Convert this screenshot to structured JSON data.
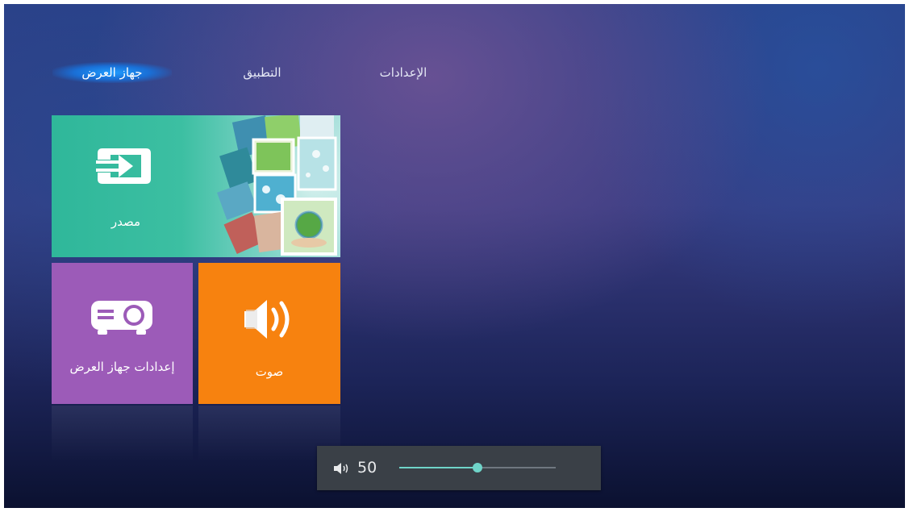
{
  "nav": {
    "tabs": [
      {
        "label": "جهاز العرض",
        "active": true
      },
      {
        "label": "التطبيق",
        "active": false
      },
      {
        "label": "الإعدادات",
        "active": false
      }
    ]
  },
  "tiles": {
    "source": {
      "label": "مصدر",
      "icon": "input-arrow-icon",
      "color": "#2fb79a"
    },
    "projector_settings": {
      "label": "إعدادات جهاز العرض",
      "icon": "projector-icon",
      "color": "#9c5bb8"
    },
    "sound": {
      "label": "صوت",
      "icon": "speaker-icon",
      "color": "#f7820f"
    }
  },
  "volume": {
    "icon": "speaker-volume-icon",
    "value": "50",
    "level": 0.5,
    "accent": "#6fd4c9"
  }
}
